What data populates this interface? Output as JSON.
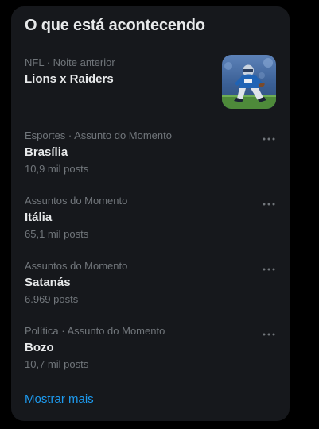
{
  "panel": {
    "title": "O que está acontecendo"
  },
  "featured": {
    "meta": "NFL · Noite anterior",
    "name": "Lions x Raiders",
    "image_icon": "football-player-photo"
  },
  "trends": [
    {
      "meta": "Esportes · Assunto do Momento",
      "name": "Brasília",
      "count": "10,9 mil posts"
    },
    {
      "meta": "Assuntos do Momento",
      "name": "Itália",
      "count": "65,1 mil posts"
    },
    {
      "meta": "Assuntos do Momento",
      "name": "Satanás",
      "count": "6.969 posts"
    },
    {
      "meta": "Política · Assunto do Momento",
      "name": "Bozo",
      "count": "10,7 mil posts"
    }
  ],
  "more_icon": "more-horizontal-icon",
  "show_more_label": "Mostrar mais",
  "colors": {
    "background": "#000000",
    "panel": "#16181c",
    "primary_text": "#e7e9ea",
    "secondary_text": "#71767b",
    "link": "#1d9bf0"
  }
}
